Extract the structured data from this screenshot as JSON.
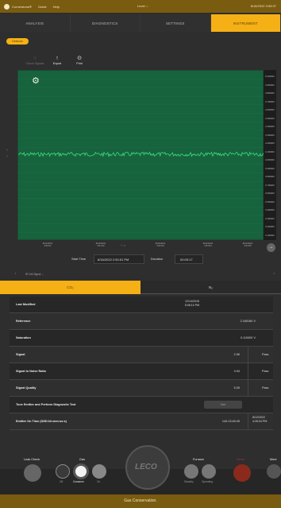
{
  "topbar": {
    "app": "Cornerstone®",
    "menu1": "Guide",
    "menu2": "Help",
    "center": "Level",
    "right": "8/16/2022 3:55:37"
  },
  "tabs": [
    {
      "label": "ANALYSIS",
      "active": false
    },
    {
      "label": "DIAGNOSTICS",
      "active": false
    },
    {
      "label": "SETTINGS",
      "active": false
    },
    {
      "label": "INSTRUMENT",
      "active": true
    }
  ],
  "pill": "Detector",
  "toolbar": {
    "check": "Check Signals",
    "export": "Export",
    "print": "Print"
  },
  "chart_data": {
    "type": "line",
    "series": [
      {
        "values": []
      }
    ],
    "ylim": [
      0,
      1
    ],
    "y_ticks": [
      "5.000000",
      "4.900000",
      "4.800000",
      "4.700000",
      "4.600000",
      "4.500000",
      "4.400000",
      "4.300000",
      "4.200000",
      "4.100000",
      "4.000000",
      "3.900000",
      "3.800000",
      "3.700000",
      "3.600000",
      "3.500000",
      "3.400000",
      "3.300000",
      "3.200000",
      "3.100000"
    ],
    "x_ticks": [
      {
        "line1": "8/16/2022",
        "line2": "3:50:51"
      },
      {
        "line1": "8/16/2022",
        "line2": "3:51:52"
      },
      {
        "line1": "8/16/2022",
        "line2": "3:52:53"
      },
      {
        "line1": "8/16/2022",
        "line2": "3:53:54"
      },
      {
        "line1": "8/16/2022",
        "line2": "3:54:55"
      }
    ]
  },
  "start_time_label": "Start Time",
  "start_time_value": "8/16/2022 2:50:51 PM",
  "duration_label": "Duration",
  "duration_value": "00:05:17",
  "signal_select": "IR Cell Signal",
  "subtabs": [
    {
      "label": "CO₂",
      "active": true
    },
    {
      "label": "N₂",
      "active": false
    }
  ],
  "rows": [
    {
      "label": "Last Modified",
      "mid": "12/14/2016\n5:08:10 PM"
    },
    {
      "label": "Reference",
      "value": "2.165160 V"
    },
    {
      "label": "Saturation",
      "value": "0.110000 V"
    },
    {
      "label": "Signal",
      "value": "2.96",
      "status": "Pass"
    },
    {
      "label": "Signal to Noise Ratio",
      "value": "4.94",
      "status": "Pass"
    },
    {
      "label": "Signal Quality",
      "value": "5.05",
      "status": "Pass"
    },
    {
      "label": "Tune Emitter and Perform Diagnostic Test",
      "button": "Start"
    },
    {
      "label": "Emitter On Time (DDD:hh:mm:ss:s)",
      "value": "144:13:45:49",
      "right": "8/12/2022\n4:26:04 PM"
    }
  ],
  "bottom": {
    "leak_check": "Leak Check",
    "gas": "Gas",
    "gas_off": "Off",
    "gas_conserve": "Conserve",
    "gas_on": "On",
    "logo": "LECO",
    "furnace": "Furnace",
    "furnace_standby": "Standby",
    "furnace_operating": "Operating",
    "reset": "Reset",
    "more": "More"
  },
  "status_bar": "Gas Conservation."
}
